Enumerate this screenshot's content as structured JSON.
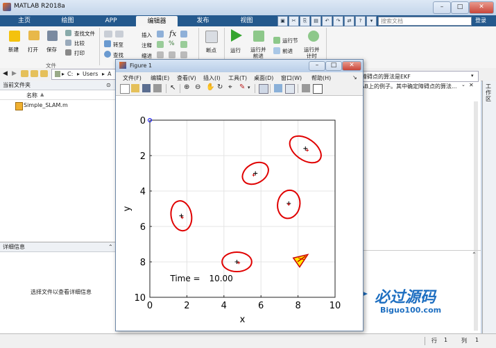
{
  "app": {
    "title": "MATLAB R2018a"
  },
  "tabs": [
    "主页",
    "绘图",
    "APP",
    "编辑器",
    "发布",
    "视图"
  ],
  "search": {
    "placeholder": "搜索文档"
  },
  "login": "登录",
  "toolstrip": {
    "new": "新建",
    "open": "打开",
    "save": "保存",
    "find_files": "查找文件",
    "compare": "比较",
    "print": "打印",
    "goto": "转至",
    "find": "查找",
    "insert": "插入",
    "comment": "注释",
    "indent": "缩进",
    "breakpoints": "断点",
    "run": "运行",
    "run_advance": "运行并\n前进",
    "run_section": "运行节",
    "advance": "前进",
    "run_time": "运行并\n计时",
    "section_file": "文件"
  },
  "address": {
    "path": [
      "C:",
      "Users",
      "A"
    ]
  },
  "current_folder": {
    "title": "当前文件夹",
    "col_name": "名称",
    "files": [
      "Simple_SLAM.m"
    ]
  },
  "details": {
    "title": "详细信息",
    "empty_msg": "选择文件以查看详细信息"
  },
  "editor_text": {
    "line1": "障碍点的算法是EKF",
    "line2": "AB上的例子。其中确定障碍点的算法..."
  },
  "workspace": {
    "title": "工作区"
  },
  "status": {
    "row_label": "行",
    "row": "1",
    "col_label": "列",
    "col": "1"
  },
  "figure": {
    "title": "Figure 1",
    "menus": [
      "文件(F)",
      "编辑(E)",
      "查看(V)",
      "插入(I)",
      "工具(T)",
      "桌面(D)",
      "窗口(W)",
      "帮助(H)"
    ],
    "time_label": "Time =",
    "time_value": "10.00"
  },
  "watermark": {
    "cn": "必过源码",
    "en": "Biguo100.com"
  },
  "chart_data": {
    "type": "scatter",
    "xlabel": "x",
    "ylabel": "y",
    "xlim": [
      0,
      10
    ],
    "ylim": [
      0,
      10
    ],
    "y_reversed": true,
    "xticks": [
      "0",
      "2",
      "4",
      "6",
      "8",
      "10"
    ],
    "yticks": [
      "0",
      "2",
      "4",
      "6",
      "8",
      "10"
    ],
    "grid": true,
    "origin_marker": {
      "x": 0,
      "y": 0,
      "color": "#0000ff"
    },
    "landmarks_true": [
      [
        1.7,
        5.4
      ],
      [
        4.7,
        8.0
      ],
      [
        5.7,
        3.0
      ],
      [
        7.5,
        4.7
      ],
      [
        8.4,
        1.6
      ]
    ],
    "landmarks_est": [
      [
        1.75,
        5.5
      ],
      [
        4.8,
        8.05
      ],
      [
        5.6,
        3.1
      ],
      [
        7.5,
        4.75
      ],
      [
        8.5,
        1.7
      ]
    ],
    "covariance_ellipses": [
      {
        "cx": 1.7,
        "cy": 5.4,
        "rx": 0.55,
        "ry": 0.85,
        "angle": -10
      },
      {
        "cx": 4.7,
        "cy": 8.0,
        "rx": 0.8,
        "ry": 0.55,
        "angle": 0
      },
      {
        "cx": 5.7,
        "cy": 3.0,
        "rx": 0.75,
        "ry": 0.55,
        "angle": -30
      },
      {
        "cx": 7.5,
        "cy": 4.75,
        "rx": 0.6,
        "ry": 0.8,
        "angle": 10
      },
      {
        "cx": 8.4,
        "cy": 1.65,
        "rx": 0.95,
        "ry": 0.6,
        "angle": 35
      }
    ],
    "robot": {
      "x": 8.1,
      "y": 7.9,
      "heading_deg": -35,
      "color": "#ffe600",
      "edge": "#cc0000"
    },
    "ellipse_color": "#e00000"
  }
}
